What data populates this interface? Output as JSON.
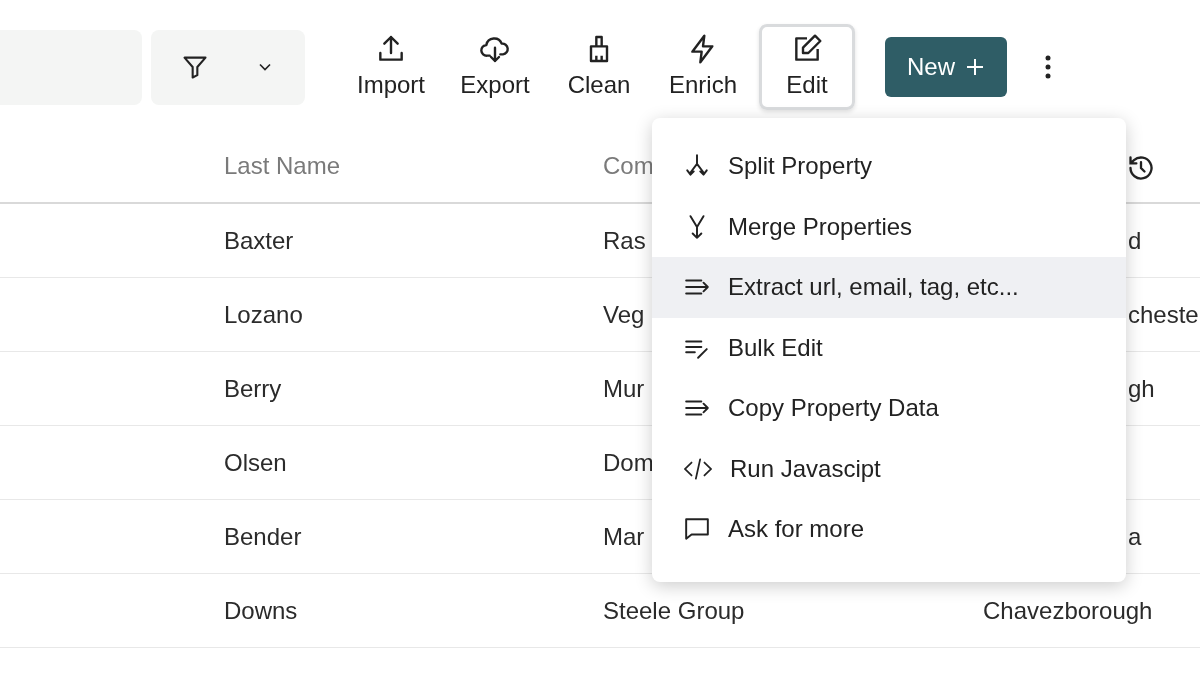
{
  "toolbar": {
    "filter": {
      "expanded": false
    },
    "actions": [
      {
        "kind": "import",
        "label": "Import",
        "selected": false
      },
      {
        "kind": "export",
        "label": "Export",
        "selected": false
      },
      {
        "kind": "clean",
        "label": "Clean",
        "selected": false
      },
      {
        "kind": "enrich",
        "label": "Enrich",
        "selected": false
      },
      {
        "kind": "edit",
        "label": "Edit",
        "selected": true
      }
    ],
    "new_button": {
      "label": "New"
    }
  },
  "table": {
    "columns": [
      {
        "label": "Last Name"
      },
      {
        "label": "Com"
      }
    ],
    "rows": [
      {
        "cells": [
          "Baxter",
          "Ras",
          "d"
        ]
      },
      {
        "cells": [
          "Lozano",
          "Veg",
          "cheste"
        ]
      },
      {
        "cells": [
          "Berry",
          "Mur",
          "gh"
        ]
      },
      {
        "cells": [
          "Olsen",
          "Dom"
        ]
      },
      {
        "cells": [
          "Bender",
          "Mar",
          "a"
        ]
      },
      {
        "cells": [
          "Downs",
          "Steele Group",
          "Chavezborough"
        ]
      }
    ]
  },
  "menu": {
    "items": [
      {
        "kind": "split",
        "label": "Split Property",
        "selected": false
      },
      {
        "kind": "merge",
        "label": "Merge Properties",
        "selected": false
      },
      {
        "kind": "extract",
        "label": "Extract url, email, tag, etc...",
        "selected": true
      },
      {
        "kind": "bulk",
        "label": "Bulk Edit",
        "selected": false
      },
      {
        "kind": "copy",
        "label": "Copy Property Data",
        "selected": false
      },
      {
        "kind": "code",
        "label": "Run Javascipt",
        "selected": false
      },
      {
        "kind": "chat",
        "label": "Ask for more",
        "selected": false
      }
    ]
  }
}
